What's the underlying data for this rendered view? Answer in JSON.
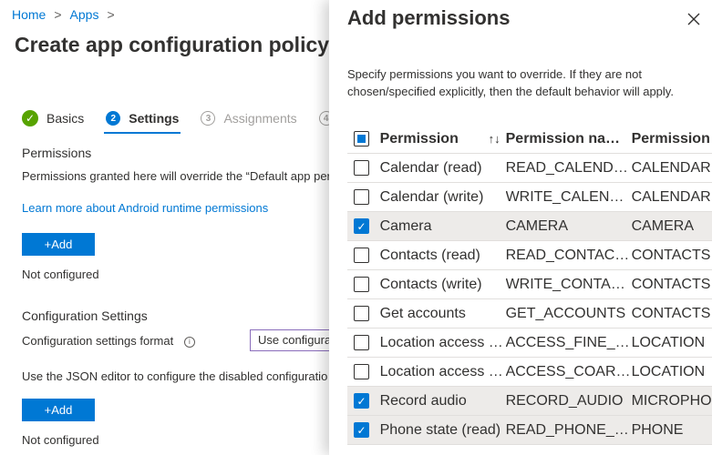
{
  "breadcrumb": {
    "home": "Home",
    "apps": "Apps",
    "separator": ">"
  },
  "page_title": "Create app configuration policy",
  "steps": [
    {
      "label": "Basics",
      "number": "",
      "state": "done"
    },
    {
      "label": "Settings",
      "number": "2",
      "state": "active"
    },
    {
      "label": "Assignments",
      "number": "3",
      "state": "inactive"
    },
    {
      "label": "",
      "number": "4",
      "state": "inactive"
    }
  ],
  "permissions_section": {
    "heading": "Permissions",
    "description": "Permissions granted here will override the “Default app per",
    "learn_more": "Learn more about Android runtime permissions",
    "add_label": "+Add",
    "status": "Not configured"
  },
  "config_section": {
    "heading": "Configuration Settings",
    "format_label": "Configuration settings format",
    "format_value": "Use configura",
    "json_text": "Use the JSON editor to configure the disabled configuratio",
    "add_label": "+Add",
    "status": "Not configured"
  },
  "panel": {
    "title": "Add permissions",
    "description": "Specify permissions you want to override. If they are not chosen/specified explicitly, then the default behavior will apply.",
    "columns": {
      "permission": "Permission",
      "permission_name": "Permission name",
      "group": "Permission",
      "sort_glyph": "↑↓"
    },
    "rows": [
      {
        "permission": "Calendar (read)",
        "name": "READ_CALENDAR",
        "group": "CALENDAR",
        "checked": false
      },
      {
        "permission": "Calendar (write)",
        "name": "WRITE_CALENDAR",
        "group": "CALENDAR",
        "checked": false
      },
      {
        "permission": "Camera",
        "name": "CAMERA",
        "group": "CAMERA",
        "checked": true
      },
      {
        "permission": "Contacts (read)",
        "name": "READ_CONTACTS",
        "group": "CONTACTS",
        "checked": false
      },
      {
        "permission": "Contacts (write)",
        "name": "WRITE_CONTACTS",
        "group": "CONTACTS",
        "checked": false
      },
      {
        "permission": "Get accounts",
        "name": "GET_ACCOUNTS",
        "group": "CONTACTS",
        "checked": false
      },
      {
        "permission": "Location access (fine)",
        "name": "ACCESS_FINE_LOCA...",
        "group": "LOCATION",
        "checked": false
      },
      {
        "permission": "Location access (coa...",
        "name": "ACCESS_COARSE_LO...",
        "group": "LOCATION",
        "checked": false
      },
      {
        "permission": "Record audio",
        "name": "RECORD_AUDIO",
        "group": "MICROPHO",
        "checked": true
      },
      {
        "permission": "Phone state (read)",
        "name": "READ_PHONE_STATE",
        "group": "PHONE",
        "checked": true
      }
    ]
  }
}
